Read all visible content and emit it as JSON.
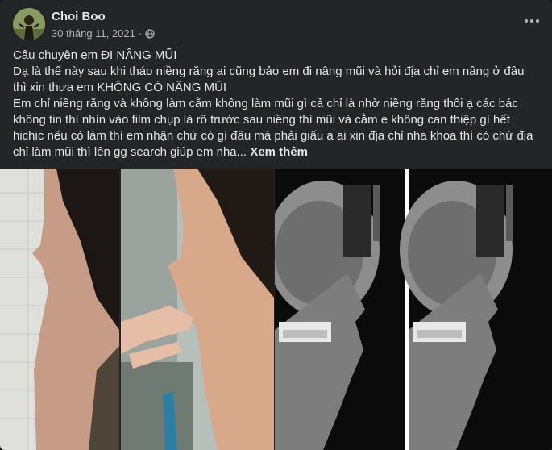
{
  "post": {
    "author": "Choi Boo",
    "timestamp": "30 tháng 11, 2021",
    "separator": "·",
    "lines": [
      "Câu chuyện em ĐI NÂNG MŨI",
      "Dạ là thế này sau khi tháo niềng răng ai cũng bảo em đi nâng mũi và hỏi địa chỉ em nâng ở đâu thì xin thưa em KHÔNG CÓ NÂNG MŨI",
      "Em chỉ niềng răng và không làm cằm không làm mũi gì cả chỉ là nhờ niềng răng thôi ạ các bác không tin thì nhìn vào film chụp là rõ trước sau niềng thì mũi và cằm e không can thiệp gì hết hichic nếu có làm thì em nhận chứ có gì đâu mà phải giấu ạ ai xin địa chỉ nha khoa thì có chứ địa chỉ làm mũi thì lên gg search giúp em nha..."
    ],
    "see_more": "Xem thêm"
  },
  "icons": {
    "privacy": "globe-icon",
    "menu": "more-options-icon"
  },
  "colors": {
    "card_bg": "#242526",
    "text_primary": "#e4e6eb",
    "text_secondary": "#b0b3b8"
  }
}
